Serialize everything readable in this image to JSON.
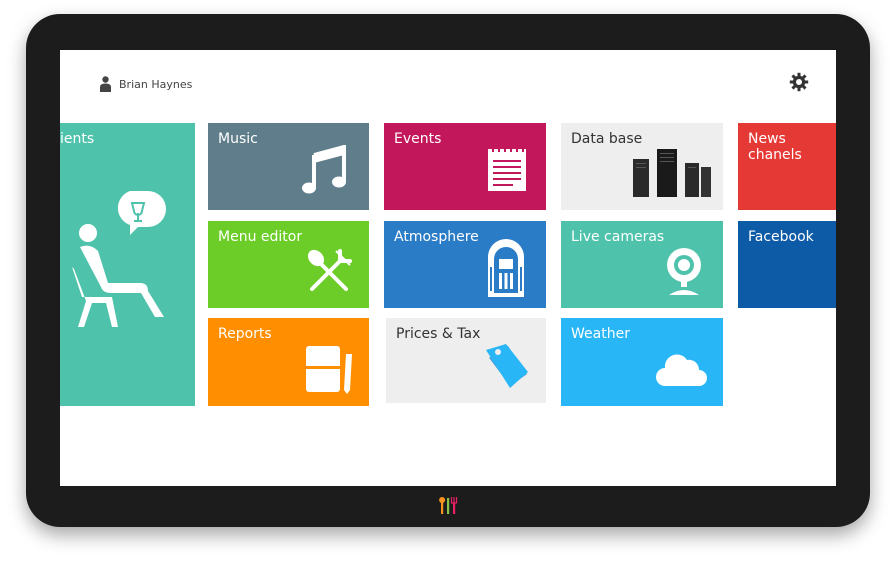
{
  "header": {
    "user_name": "Brian Haynes",
    "user_icon": "person-icon",
    "settings_icon": "gear-icon"
  },
  "tiles": {
    "clients": {
      "label": "ients",
      "color": "#4fc2ab",
      "icon": "client-seated-icon"
    },
    "music": {
      "label": "Music",
      "color": "#607d8b",
      "icon": "music-note-icon"
    },
    "events": {
      "label": "Events",
      "color": "#c2185b",
      "icon": "calendar-icon"
    },
    "database": {
      "label": "Data base",
      "color": "#eeeeee",
      "icon": "server-icon"
    },
    "news": {
      "label": "News chanels",
      "color": "#e53935",
      "icon": ""
    },
    "menu_editor": {
      "label": "Menu editor",
      "color": "#6ccd28",
      "icon": "cutlery-icon"
    },
    "atmosphere": {
      "label": "Atmosphere",
      "color": "#2a7cc7",
      "icon": "jukebox-icon"
    },
    "live_cameras": {
      "label": "Live cameras",
      "color": "#4fc2ab",
      "icon": "webcam-icon"
    },
    "facebook": {
      "label": "Facebook",
      "color": "#0d5ba6",
      "icon": ""
    },
    "reports": {
      "label": "Reports",
      "color": "#ff8f00",
      "icon": "notebook-icon"
    },
    "prices_tax": {
      "label": "Prices & Tax",
      "color": "#eeeeee",
      "icon": "price-tag-icon"
    },
    "weather": {
      "label": "Weather",
      "color": "#29b6f6",
      "icon": "cloud-icon"
    }
  },
  "device": {
    "logo_icon": "cutlery-logo-icon"
  }
}
